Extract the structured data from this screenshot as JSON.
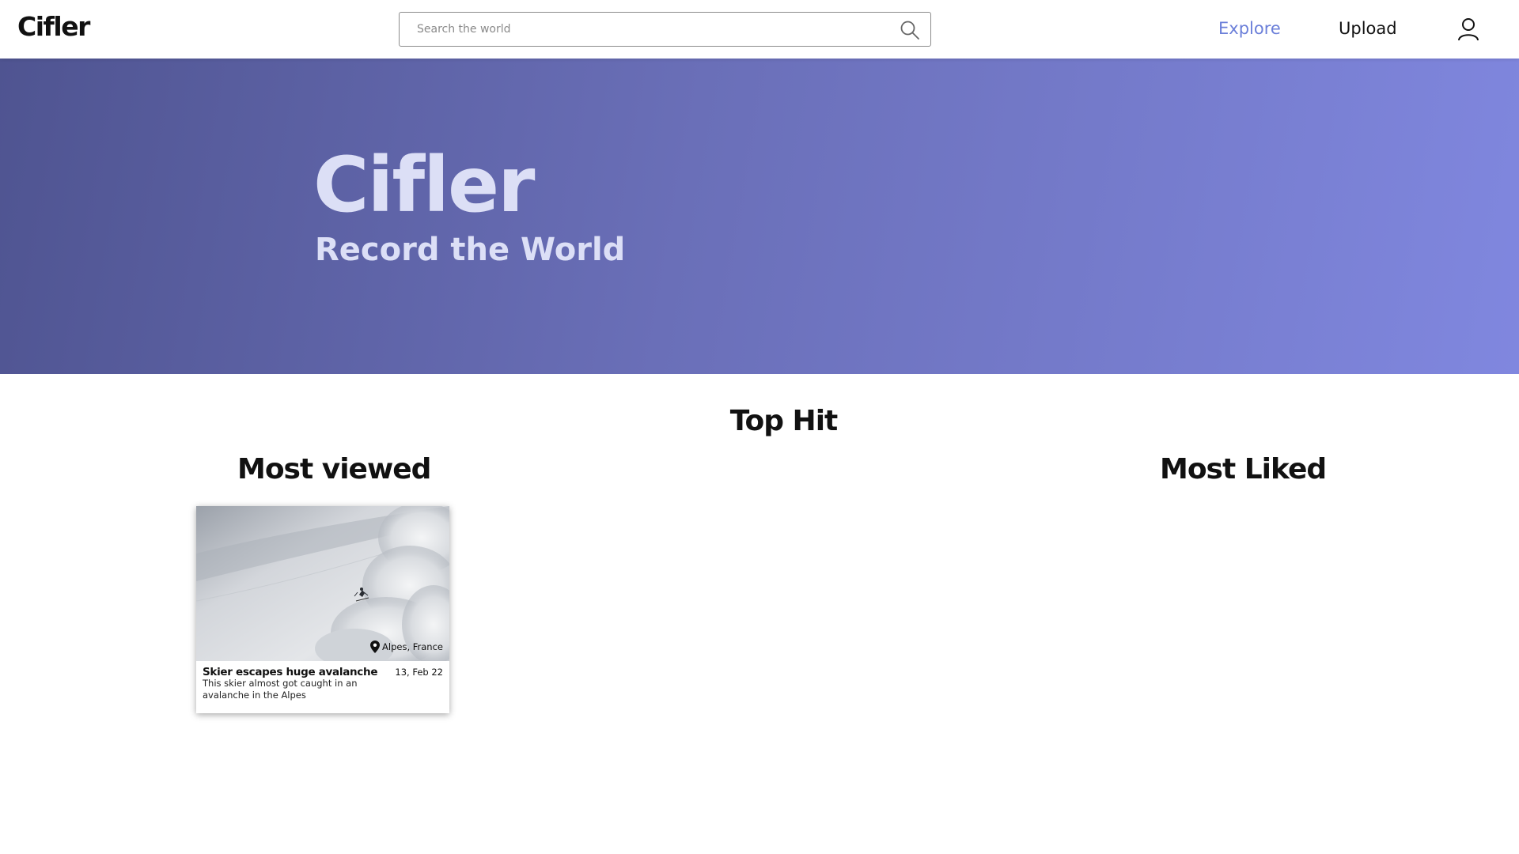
{
  "header": {
    "logo": "Cifler",
    "search_placeholder": "Search the world",
    "nav": {
      "explore": "Explore",
      "upload": "Upload"
    },
    "explore_color": "#6b7fd9"
  },
  "hero": {
    "title": "Cifler",
    "subtitle": "Record the World",
    "gradient_start": "#4f5491",
    "gradient_end": "#8087df"
  },
  "sections": {
    "top_hit": "Top Hit",
    "most_viewed": "Most viewed",
    "most_liked": "Most Liked"
  },
  "cards": [
    {
      "title": "Skier escapes huge avalanche",
      "date": "13, Feb 22",
      "description": "This skier almost got caught in an avalanche in the Alpes",
      "location": "Alpes, France"
    }
  ],
  "icons": {
    "search": "search-icon",
    "user": "user-icon",
    "pin": "location-pin-icon"
  }
}
